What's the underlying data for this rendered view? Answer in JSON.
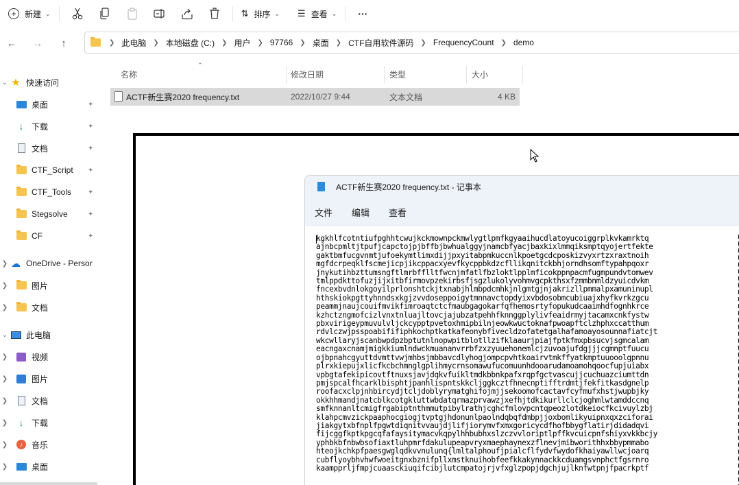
{
  "toolbar": {
    "new_label": "新建",
    "sort_label": "排序",
    "view_label": "查看",
    "more_label": "···"
  },
  "address": {
    "crumbs": [
      "此电脑",
      "本地磁盘 (C:)",
      "用户",
      "97766",
      "桌面",
      "CTF自用软件源码",
      "FrequencyCount",
      "demo"
    ]
  },
  "sidebar": {
    "quick_access": "快速访问",
    "items": [
      {
        "label": "桌面"
      },
      {
        "label": "下载"
      },
      {
        "label": "文档"
      },
      {
        "label": "CTF_Script"
      },
      {
        "label": "CTF_Tools"
      },
      {
        "label": "Stegsolve"
      },
      {
        "label": "CF"
      }
    ],
    "onedrive": "OneDrive - Persor",
    "onedrive_items": [
      {
        "label": "图片"
      },
      {
        "label": "文档"
      }
    ],
    "this_pc": "此电脑",
    "pc_items": [
      {
        "label": "视频"
      },
      {
        "label": "图片"
      },
      {
        "label": "文档"
      },
      {
        "label": "下载"
      },
      {
        "label": "音乐"
      },
      {
        "label": "桌面"
      }
    ]
  },
  "columns": {
    "name": "名称",
    "date": "修改日期",
    "type": "类型",
    "size": "大小"
  },
  "file": {
    "name": "ACTF新生赛2020 frequency.txt",
    "date": "2022/10/27 9:44",
    "type": "文本文档",
    "size": "4 KB"
  },
  "notepad": {
    "title": "ACTF新生赛2020 frequency.txt - 记事本",
    "menu": [
      "文件",
      "编辑",
      "查看"
    ],
    "lines": [
      "kgkhlfcotntiufpghhtcwujkckmownpckmwlygtlpmfkgyaaihucdlatoyucoiggrplkvkamrktq",
      "ajnbcpmltjtpufjcapctojpjbffbjbwhualggyjnamcbfyacjbaxkixlmmqiksmptqyojertfekte",
      "gaktbmfucgvnmtjufoekymtlimxdijjpxyitabpmkuccnlkpoetgcdcposkizvyxrtzxraxtnoih",
      "mgfdcrpeqklfscmejicpjikcppacxyevfkycppbkdzcfllikqnitckbhjorndhsomftypahpqoxr",
      "jnykutihbzttumsngftlmrbfflltfwcnjmfatlfbzloktlpplmficokppnpacmfugmpundvtomwev",
      "tmlppdkttofuzjijxitbfirmovpzekirbsfjsgzlukolyvohmvgcpkthsxfzmmbnmldzyuicdvkm",
      "fncexbvdnlokgoyilprlonshtckjtxnabjhlmbpdcmhkjnlgmtgjnjakrizllpmmalpxamuninupl",
      "hthskiokpgttyhnndsxkgjzvvdoseppoigytmnnavctopdyixvbdosobmcubiuajxhyfkvrkzgcu",
      "peammjnaujcouifmvikfimroaqtctcfmaubgagokarfqfhemosrtyfopukudcaaimhdfognhkrce",
      "kzhctzngmofcizlvnxtnluajltovcjajubzatpehhfknnggplylivfeaidrmyjtacamxcnkfystw",
      "pbxvirigeypmuvulvljckcypptpvetoxhmipbilnjeowkwuctoknafpwoapftclzhphxccatthum",
      "rdvlczwjpsspoabififiphkochptkatkafeonybfivecldzofatetgalhafamoayosounnafiatcjt",
      "wkcwllaryjscanbwpdpzbptutnlnopwpitblotllzifklaaurjpiajfptkfmxpbsucvjsgmcalam",
      "eacngaxcnamjmigkkiumlndwckmuananvrrbfzxzyuuehonemlcjzuvoajufdgjjjcgmnptfuucu",
      "ojbpnahcgyuttdvmttvwjmhbsjmbbavcdlyhogjompcpvhtkoairvtmkffyatkmptuuooolgpnnu",
      "plrxkiepujxlicfkcbchmnglgplihmycrnsomawufucomuunhdooarudamoamohqoocfupjuiabx",
      "vpbgtafekipicovtftnuxsjavjdqkvfuikltmdkbbnkpafxrqpfgctvascujjcuchuazciumttdn",
      "pmjspcalfhcarklbisphtjpanhlispntskkcljggkcztfhnecnptifftrdmtjfekfitkasdgnelp",
      "roofacxclpjnhbircydjtcljdoblyrymatghifojmjjsekoomofcactavfcyfmufxhstjwupbjky",
      "okkhhmandjnatcblkcotgkluttwbdatqrmazprvawzjxefhjtdkikurllclcjoghmlwtamddccnq",
      "smfknnanltcmigfrgabiptnthmmutpibylrathjcghcfmlovpcntqpeozlotdkeiocfkcivuylzbj",
      "klahpcmvzickpaaphocgiogjtvptgjhdonunlpaolndqbqfdmbpjjoxbomlikyuipnxqxzciforai",
      "jiakgytxbfnplfpgwtdiqnitvvaujdjlifjiorymvfxmxgoricycdfhofbbygflatirjdidadqvi",
      "fijcggfkptkpgcqfafaysitymacvkqpylhhbubhxslzczvvloriptlpffkvcuicpnfshiyxvkkbcjy",
      "yphbkbfnbwbsofiaxtluhpmrfdakulupeapvryxmaephaynexzflnevjmibworithhxbbypmmabo",
      "hteojkchkpfpaesgwglqdkvvnulunq{lmltalphoufjpialcflfydvfwydofkhaiyawllwcjoarq",
      "cubflyoybhvhwfwoeitgnxbznifpllxmstknuihobfeefkkakynnackkcduamgsvnphctfgsrnro",
      "kaampprljfmpjcuaasckiuqifcibjlutcmpatojrjvfxglzpopjdgchjujlknfwtpnjfpacrkptf"
    ]
  }
}
